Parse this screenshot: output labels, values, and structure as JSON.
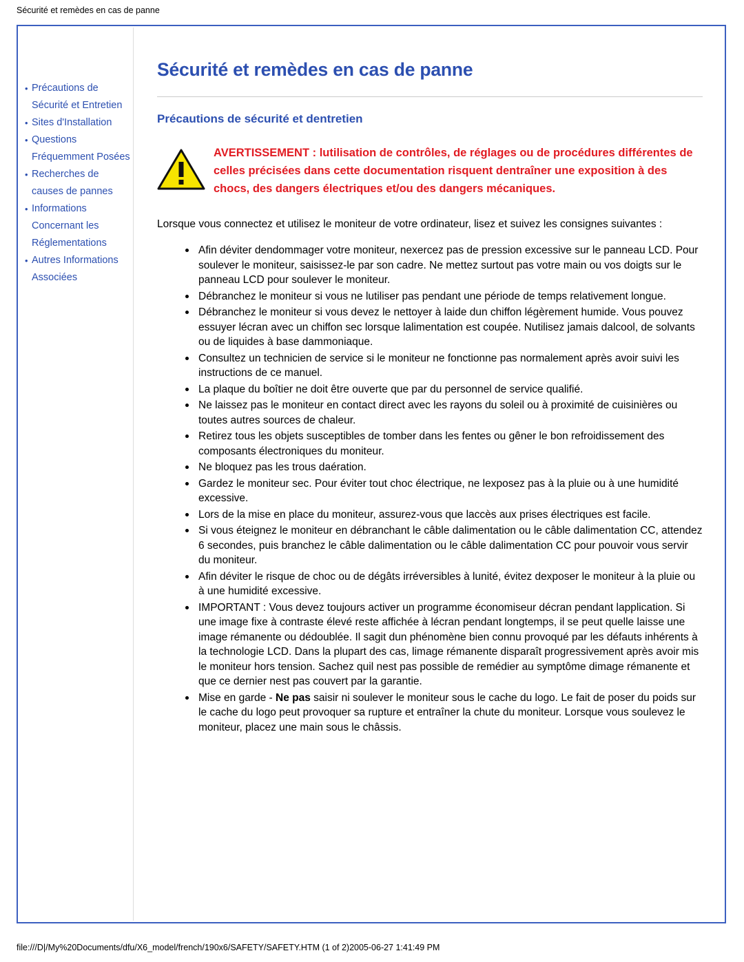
{
  "browser": {
    "header_text": "Sécurité et remèdes en cas de panne",
    "footer_text": "file:///D|/My%20Documents/dfu/X6_model/french/190x6/SAFETY/SAFETY.HTM (1 of 2)2005-06-27 1:41:49 PM"
  },
  "sidebar": {
    "items": [
      {
        "bullet": "•",
        "label": "Précautions de Sécurité et Entretien"
      },
      {
        "bullet": "•",
        "label": "Sites d'Installation"
      },
      {
        "bullet": "•",
        "label": "Questions Fréquemment Posées"
      },
      {
        "bullet": "•",
        "label": "Recherches de causes de pannes"
      },
      {
        "bullet": "•",
        "label": "Informations Concernant les Réglementations"
      },
      {
        "bullet": "•",
        "label": "Autres Informations Associées"
      }
    ]
  },
  "main": {
    "title": "Sécurité et remèdes en cas de panne",
    "section_title": "Précautions de sécurité et dentretien",
    "warning": {
      "icon": "warning-triangle-icon",
      "text": "AVERTISSEMENT : lutilisation de contrôles, de réglages ou de procédures différentes de celles précisées dans cette documentation risquent dentraîner une exposition à des chocs, des dangers électriques et/ou des dangers mécaniques."
    },
    "intro": "Lorsque vous connectez et utilisez le moniteur de votre ordinateur, lisez et suivez les consignes suivantes :",
    "bullets": [
      "Afin déviter dendommager votre moniteur, nexercez pas de pression excessive sur le panneau LCD. Pour soulever le moniteur, saisissez-le par son cadre. Ne mettez surtout pas votre main ou vos doigts sur le panneau LCD pour soulever le moniteur.",
      "Débranchez le moniteur si vous ne lutiliser pas pendant une période de temps relativement longue.",
      "Débranchez le moniteur si vous devez le nettoyer à laide dun chiffon légèrement humide. Vous pouvez essuyer lécran avec un chiffon sec lorsque lalimentation est coupée. Nutilisez jamais dalcool, de solvants ou de liquides à base dammoniaque.",
      "Consultez un technicien de service si le moniteur ne fonctionne pas normalement après avoir suivi les instructions de ce manuel.",
      "La plaque du boîtier ne doit être ouverte que par du personnel de service qualifié.",
      "Ne laissez pas le moniteur en contact direct avec les rayons du soleil ou à proximité de cuisinières ou toutes autres sources de chaleur.",
      "Retirez tous les objets susceptibles de tomber dans les fentes ou gêner le bon refroidissement des composants électroniques du moniteur.",
      "Ne bloquez pas les trous daération.",
      "Gardez le moniteur sec. Pour éviter tout choc électrique, ne lexposez pas à la pluie ou à une humidité excessive.",
      "Lors de la mise en place du moniteur, assurez-vous que laccès aux prises électriques est facile.",
      "Si vous éteignez le moniteur en débranchant le câble dalimentation ou le câble dalimentation CC, attendez 6 secondes, puis branchez le câble dalimentation ou le câble dalimentation CC pour pouvoir vous servir du moniteur.",
      "Afin déviter le risque de choc ou de dégâts irréversibles à lunité, évitez dexposer le moniteur à la pluie ou à une humidité excessive.",
      "IMPORTANT : Vous devez toujours activer un programme économiseur décran pendant lapplication. Si une image fixe à contraste élevé reste affichée à lécran pendant longtemps, il se peut quelle laisse une image rémanente ou dédoublée. Il sagit dun phénomène bien connu provoqué par les défauts inhérents à la technologie LCD. Dans la plupart des cas, limage rémanente disparaît progressivement après avoir mis le moniteur hors tension. Sachez quil nest pas possible de remédier au symptôme dimage rémanente et que ce dernier nest pas couvert par la garantie."
    ],
    "last_bullet": {
      "prefix": "Mise en garde - ",
      "bold": "Ne pas",
      "suffix": " saisir ni soulever le moniteur sous le cache du logo. Le fait de poser du poids sur le cache du logo peut provoquer sa rupture et entraîner la chute du moniteur. Lorsque vous soulevez le moniteur, placez une main sous le châssis."
    }
  },
  "colors": {
    "accent": "#2c4fb0",
    "warning": "#e11b22",
    "frame": "#3b5fc0"
  }
}
